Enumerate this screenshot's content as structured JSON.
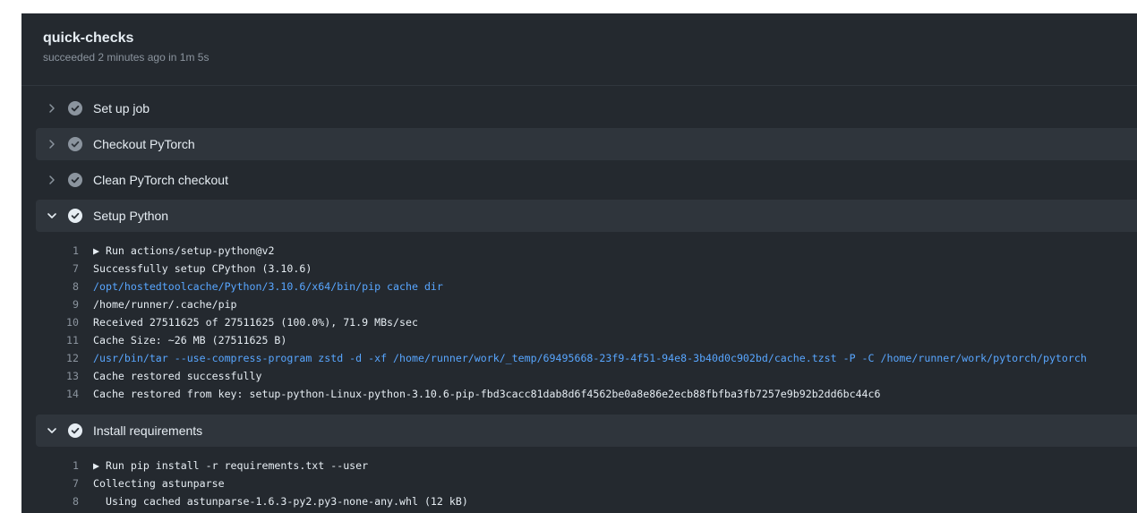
{
  "job": {
    "title": "quick-checks",
    "subtitle": "succeeded 2 minutes ago in 1m 5s"
  },
  "steps": [
    {
      "label": "Set up job",
      "expanded": false,
      "icon": "check-circle-icon"
    },
    {
      "label": "Checkout PyTorch",
      "expanded": false,
      "icon": "check-circle-icon"
    },
    {
      "label": "Clean PyTorch checkout",
      "expanded": false,
      "icon": "check-circle-icon"
    },
    {
      "label": "Setup Python",
      "expanded": true,
      "icon": "check-circle-icon"
    },
    {
      "label": "Install requirements",
      "expanded": true,
      "icon": "check-circle-icon"
    }
  ],
  "setup_python_log": [
    {
      "n": "1",
      "text": "▶ Run actions/setup-python@v2",
      "kind": "group"
    },
    {
      "n": "7",
      "text": "Successfully setup CPython (3.10.6)",
      "kind": "text"
    },
    {
      "n": "8",
      "text": "/opt/hostedtoolcache/Python/3.10.6/x64/bin/pip cache dir",
      "kind": "command"
    },
    {
      "n": "9",
      "text": "/home/runner/.cache/pip",
      "kind": "text"
    },
    {
      "n": "10",
      "text": "Received 27511625 of 27511625 (100.0%), 71.9 MBs/sec",
      "kind": "text"
    },
    {
      "n": "11",
      "text": "Cache Size: ~26 MB (27511625 B)",
      "kind": "text"
    },
    {
      "n": "12",
      "text": "/usr/bin/tar --use-compress-program zstd -d -xf /home/runner/work/_temp/69495668-23f9-4f51-94e8-3b40d0c902bd/cache.tzst -P -C /home/runner/work/pytorch/pytorch",
      "kind": "command"
    },
    {
      "n": "13",
      "text": "Cache restored successfully",
      "kind": "text"
    },
    {
      "n": "14",
      "text": "Cache restored from key: setup-python-Linux-python-3.10.6-pip-fbd3cacc81dab8d6f4562be0a8e86e2ecb88fbfba3fb7257e9b92b2dd6bc44c6",
      "kind": "text"
    }
  ],
  "install_requirements_log": [
    {
      "n": "1",
      "text": "▶ Run pip install -r requirements.txt --user",
      "kind": "group"
    },
    {
      "n": "7",
      "text": "Collecting astunparse",
      "kind": "text"
    },
    {
      "n": "8",
      "text": "  Using cached astunparse-1.6.3-py2.py3-none-any.whl (12 kB)",
      "kind": "text"
    }
  ],
  "colors": {
    "background": "#24292f",
    "step_alt": "#2f353c",
    "text": "#e6edf3",
    "muted": "#8b949e",
    "command": "#58a6ff"
  }
}
